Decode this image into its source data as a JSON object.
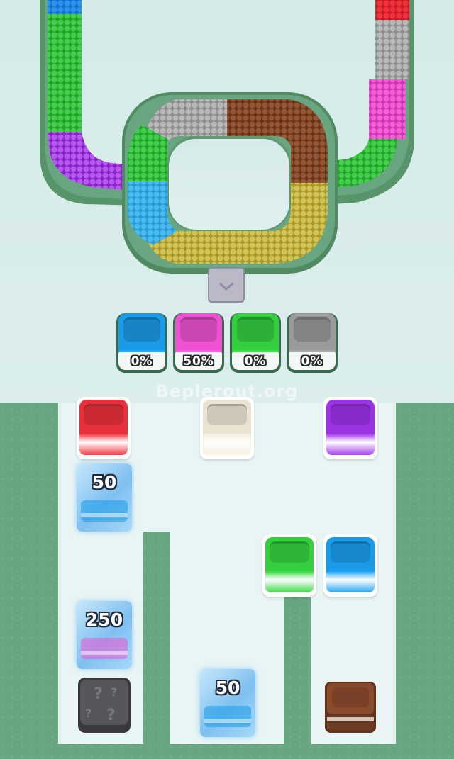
{
  "watermark": "Beplerout.org",
  "colors": {
    "background": "#d8ecea",
    "board": "#6aa581",
    "slot_bg": "#e9f5f5",
    "red": "#e8303a",
    "cream": "#ebe3d2",
    "purple": "#9b32e4",
    "green": "#34cf3f",
    "blue": "#1a9be8",
    "pink": "#ee52d2",
    "gray": "#9a9a9a",
    "brown": "#8a4a2c",
    "olive": "#c8bb48",
    "ice": "#8cc8f4"
  },
  "track": {
    "left_arm_colors": [
      "blue",
      "green",
      "purple"
    ],
    "right_arm_colors": [
      "red",
      "gray",
      "pink",
      "green"
    ],
    "loop_colors": [
      "gray",
      "brown",
      "olive",
      "blue",
      "green"
    ]
  },
  "collectors": [
    {
      "color": "blue",
      "percent": "0%"
    },
    {
      "color": "pink",
      "percent": "50%"
    },
    {
      "color": "green",
      "percent": "0%"
    },
    {
      "color": "gray",
      "percent": "0%"
    }
  ],
  "cups": [
    {
      "name": "red-cup",
      "color": "red"
    },
    {
      "name": "cream-cup",
      "color": "cream"
    },
    {
      "name": "purple-cup",
      "color": "purple"
    },
    {
      "name": "green-cup",
      "color": "green"
    },
    {
      "name": "blue-cup",
      "color": "blue"
    }
  ],
  "ice_blocks": [
    {
      "name": "ice-block-50-left",
      "count": "50",
      "inner": "blue"
    },
    {
      "name": "ice-block-250",
      "count": "250",
      "inner": "pink"
    },
    {
      "name": "ice-block-50-bottom",
      "count": "50",
      "inner": "blue"
    }
  ],
  "hidden_block": {
    "icon": "question-mark-icon"
  },
  "brown_block": {
    "color": "brown"
  }
}
